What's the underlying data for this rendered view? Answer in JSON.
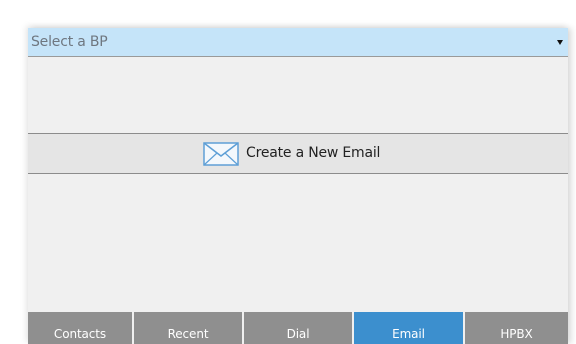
{
  "bp_select": {
    "placeholder": "Select a BP"
  },
  "new_email": {
    "label": "Create a New Email",
    "icon": "envelope-icon"
  },
  "tabs": [
    {
      "label": "Contacts",
      "active": false
    },
    {
      "label": "Recent",
      "active": false
    },
    {
      "label": "Dial",
      "active": false
    },
    {
      "label": "Email",
      "active": true
    },
    {
      "label": "HPBX",
      "active": false
    }
  ],
  "colors": {
    "select_background": "#c5e4f9",
    "tab_inactive": "#8f8f8f",
    "tab_active": "#3c8fce",
    "icon_stroke": "#5e9fd6"
  }
}
